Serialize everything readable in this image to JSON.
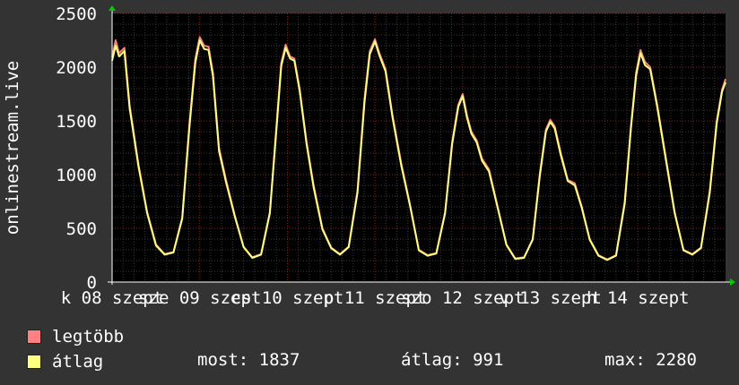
{
  "chart_data": {
    "type": "line",
    "ylabel": "onlinestream.live",
    "ylim": [
      0,
      2500
    ],
    "yticks": [
      0,
      500,
      1000,
      1500,
      2000,
      2500
    ],
    "xlim": [
      0,
      7
    ],
    "xticks": [
      {
        "label": "k 08 szept",
        "x": 0
      },
      {
        "label": "sze 09 szept",
        "x": 1
      },
      {
        "label": "cs 10 szept",
        "x": 2
      },
      {
        "label": "p 11 szept",
        "x": 3
      },
      {
        "label": "szo 12 szept",
        "x": 4
      },
      {
        "label": "v 13 szept",
        "x": 5
      },
      {
        "label": "h 14 szept",
        "x": 6
      }
    ],
    "grid": true,
    "series": [
      {
        "name": "legtöbb",
        "color": "#ff8080",
        "points": [
          [
            0.0,
            2090
          ],
          [
            0.04,
            2250
          ],
          [
            0.08,
            2130
          ],
          [
            0.14,
            2180
          ],
          [
            0.2,
            1650
          ],
          [
            0.3,
            1100
          ],
          [
            0.4,
            650
          ],
          [
            0.5,
            350
          ],
          [
            0.6,
            260
          ],
          [
            0.7,
            280
          ],
          [
            0.8,
            600
          ],
          [
            0.88,
            1450
          ],
          [
            0.95,
            2080
          ],
          [
            1.0,
            2280
          ],
          [
            1.05,
            2200
          ],
          [
            1.1,
            2190
          ],
          [
            1.15,
            1950
          ],
          [
            1.22,
            1250
          ],
          [
            1.3,
            950
          ],
          [
            1.4,
            620
          ],
          [
            1.5,
            330
          ],
          [
            1.6,
            230
          ],
          [
            1.7,
            260
          ],
          [
            1.8,
            650
          ],
          [
            1.88,
            1500
          ],
          [
            1.93,
            2040
          ],
          [
            1.98,
            2210
          ],
          [
            2.03,
            2100
          ],
          [
            2.08,
            2080
          ],
          [
            2.14,
            1800
          ],
          [
            2.22,
            1300
          ],
          [
            2.3,
            900
          ],
          [
            2.4,
            500
          ],
          [
            2.5,
            320
          ],
          [
            2.6,
            260
          ],
          [
            2.7,
            330
          ],
          [
            2.8,
            850
          ],
          [
            2.88,
            1700
          ],
          [
            2.94,
            2150
          ],
          [
            3.0,
            2260
          ],
          [
            3.05,
            2130
          ],
          [
            3.12,
            1980
          ],
          [
            3.2,
            1550
          ],
          [
            3.3,
            1100
          ],
          [
            3.4,
            720
          ],
          [
            3.5,
            300
          ],
          [
            3.6,
            250
          ],
          [
            3.7,
            270
          ],
          [
            3.8,
            650
          ],
          [
            3.88,
            1300
          ],
          [
            3.95,
            1650
          ],
          [
            4.0,
            1750
          ],
          [
            4.05,
            1550
          ],
          [
            4.1,
            1400
          ],
          [
            4.16,
            1320
          ],
          [
            4.22,
            1150
          ],
          [
            4.3,
            1050
          ],
          [
            4.4,
            700
          ],
          [
            4.5,
            350
          ],
          [
            4.6,
            220
          ],
          [
            4.7,
            230
          ],
          [
            4.8,
            400
          ],
          [
            4.88,
            1000
          ],
          [
            4.95,
            1420
          ],
          [
            5.0,
            1510
          ],
          [
            5.05,
            1450
          ],
          [
            5.12,
            1200
          ],
          [
            5.2,
            950
          ],
          [
            5.28,
            920
          ],
          [
            5.36,
            700
          ],
          [
            5.45,
            400
          ],
          [
            5.55,
            250
          ],
          [
            5.65,
            210
          ],
          [
            5.75,
            250
          ],
          [
            5.85,
            750
          ],
          [
            5.92,
            1450
          ],
          [
            5.98,
            1950
          ],
          [
            6.03,
            2160
          ],
          [
            6.08,
            2050
          ],
          [
            6.14,
            2000
          ],
          [
            6.22,
            1650
          ],
          [
            6.32,
            1150
          ],
          [
            6.42,
            650
          ],
          [
            6.52,
            300
          ],
          [
            6.62,
            260
          ],
          [
            6.72,
            320
          ],
          [
            6.82,
            850
          ],
          [
            6.9,
            1500
          ],
          [
            6.96,
            1790
          ],
          [
            7.0,
            1890
          ]
        ]
      },
      {
        "name": "átlag",
        "color": "#ffff80",
        "points": [
          [
            0.0,
            2060
          ],
          [
            0.04,
            2200
          ],
          [
            0.08,
            2100
          ],
          [
            0.14,
            2150
          ],
          [
            0.2,
            1620
          ],
          [
            0.3,
            1080
          ],
          [
            0.4,
            640
          ],
          [
            0.5,
            340
          ],
          [
            0.6,
            255
          ],
          [
            0.7,
            275
          ],
          [
            0.8,
            590
          ],
          [
            0.88,
            1420
          ],
          [
            0.95,
            2040
          ],
          [
            1.0,
            2250
          ],
          [
            1.05,
            2170
          ],
          [
            1.1,
            2160
          ],
          [
            1.15,
            1920
          ],
          [
            1.22,
            1220
          ],
          [
            1.3,
            930
          ],
          [
            1.4,
            610
          ],
          [
            1.5,
            325
          ],
          [
            1.6,
            225
          ],
          [
            1.7,
            255
          ],
          [
            1.8,
            640
          ],
          [
            1.88,
            1470
          ],
          [
            1.93,
            2010
          ],
          [
            1.98,
            2180
          ],
          [
            2.03,
            2080
          ],
          [
            2.08,
            2060
          ],
          [
            2.14,
            1780
          ],
          [
            2.22,
            1280
          ],
          [
            2.3,
            880
          ],
          [
            2.4,
            490
          ],
          [
            2.5,
            315
          ],
          [
            2.6,
            255
          ],
          [
            2.7,
            325
          ],
          [
            2.8,
            830
          ],
          [
            2.88,
            1670
          ],
          [
            2.94,
            2120
          ],
          [
            3.0,
            2240
          ],
          [
            3.05,
            2110
          ],
          [
            3.12,
            1960
          ],
          [
            3.2,
            1530
          ],
          [
            3.3,
            1080
          ],
          [
            3.4,
            710
          ],
          [
            3.5,
            295
          ],
          [
            3.6,
            245
          ],
          [
            3.7,
            265
          ],
          [
            3.8,
            640
          ],
          [
            3.88,
            1280
          ],
          [
            3.95,
            1630
          ],
          [
            4.0,
            1730
          ],
          [
            4.05,
            1530
          ],
          [
            4.1,
            1380
          ],
          [
            4.16,
            1300
          ],
          [
            4.22,
            1130
          ],
          [
            4.3,
            1030
          ],
          [
            4.4,
            690
          ],
          [
            4.5,
            345
          ],
          [
            4.6,
            215
          ],
          [
            4.7,
            225
          ],
          [
            4.8,
            395
          ],
          [
            4.88,
            980
          ],
          [
            4.95,
            1400
          ],
          [
            5.0,
            1490
          ],
          [
            5.05,
            1430
          ],
          [
            5.12,
            1180
          ],
          [
            5.2,
            940
          ],
          [
            5.28,
            900
          ],
          [
            5.36,
            690
          ],
          [
            5.45,
            395
          ],
          [
            5.55,
            245
          ],
          [
            5.65,
            205
          ],
          [
            5.75,
            245
          ],
          [
            5.85,
            730
          ],
          [
            5.92,
            1430
          ],
          [
            5.98,
            1920
          ],
          [
            6.03,
            2130
          ],
          [
            6.08,
            2020
          ],
          [
            6.14,
            1980
          ],
          [
            6.22,
            1630
          ],
          [
            6.32,
            1130
          ],
          [
            6.42,
            640
          ],
          [
            6.52,
            295
          ],
          [
            6.62,
            255
          ],
          [
            6.72,
            315
          ],
          [
            6.82,
            830
          ],
          [
            6.9,
            1480
          ],
          [
            6.96,
            1770
          ],
          [
            7.0,
            1860
          ]
        ]
      }
    ]
  },
  "legend": [
    {
      "label": "legtöbb",
      "color": "#ff8080"
    },
    {
      "label": "átlag",
      "color": "#ffff80"
    }
  ],
  "stats": {
    "most": "most: 1837",
    "atlag": "átlag: 991",
    "max": "max: 2280"
  }
}
